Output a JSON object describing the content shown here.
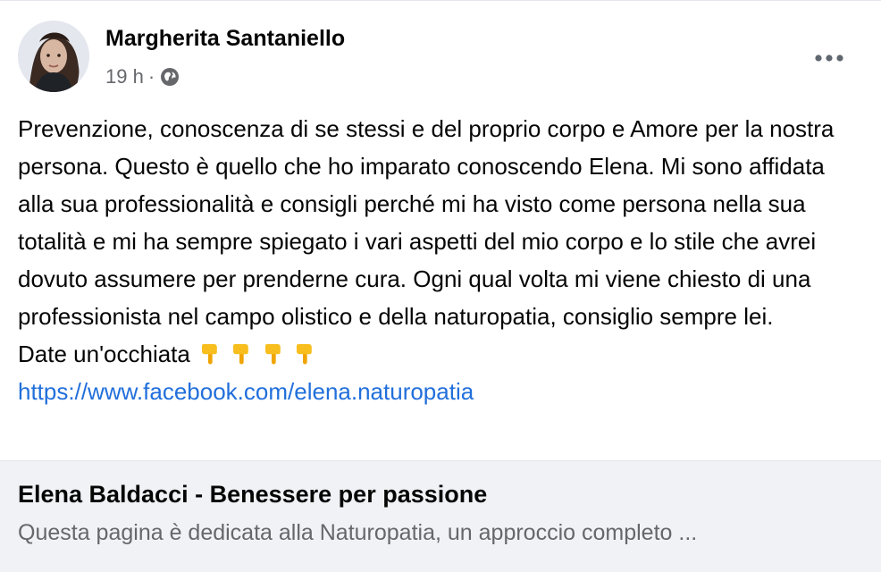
{
  "post": {
    "author": "Margherita Santaniello",
    "time": "19 h",
    "separator": "·",
    "privacy_icon": "globe-icon",
    "menu_icon": "more-horizontal-icon",
    "paragraphs": [
      "Prevenzione, conoscenza di se stessi e del proprio corpo e Amore per la nostra persona. Questo è quello che ho imparato conoscendo Elena. Mi sono affidata alla sua professionalità e consigli perché mi ha visto come persona nella sua totalità e mi ha sempre spiegato i vari aspetti del mio corpo e lo stile che avrei dovuto assumere per prenderne cura. Ogni qual volta mi viene chiesto di una professionista nel campo olistico e della naturopatia, consiglio sempre lei."
    ],
    "cta_text": "Date un'occhiata",
    "cta_icons": [
      "pointing-down-hand-icon",
      "pointing-down-hand-icon",
      "pointing-down-hand-icon",
      "pointing-down-hand-icon"
    ],
    "link_text": "https://www.facebook.com/elena.naturopatia"
  },
  "preview": {
    "title": "Elena Baldacci - Benessere per passione",
    "description": "Questa pagina è dedicata alla Naturopatia, un approccio completo ..."
  },
  "colors": {
    "link": "#216fdb",
    "secondary_text": "#65676b",
    "preview_bg": "#f0f2f5"
  }
}
